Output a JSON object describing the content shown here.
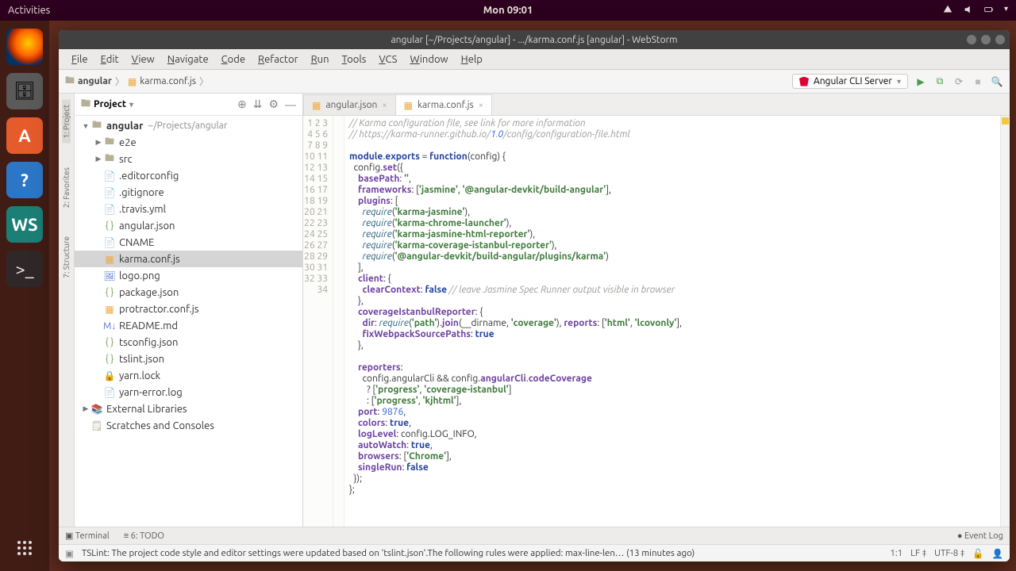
{
  "ubuntu": {
    "activities": "Activities",
    "clock": "Mon 09:01"
  },
  "window": {
    "title": "angular [~/Projects/angular] - .../karma.conf.js [angular] - WebStorm"
  },
  "menus": [
    "File",
    "Edit",
    "View",
    "Navigate",
    "Code",
    "Refactor",
    "Run",
    "Tools",
    "VCS",
    "Window",
    "Help"
  ],
  "breadcrumb": {
    "root": "angular",
    "file": "karma.conf.js"
  },
  "run_config": {
    "label": "Angular CLI Server"
  },
  "project_panel": {
    "title": "Project",
    "root_name": "angular",
    "root_path": "~/Projects/angular",
    "folders": [
      "e2e",
      "src"
    ],
    "files": [
      ".editorconfig",
      ".gitignore",
      ".travis.yml",
      "angular.json",
      "CNAME",
      "karma.conf.js",
      "logo.png",
      "package.json",
      "protractor.conf.js",
      "README.md",
      "tsconfig.json",
      "tslint.json",
      "yarn.lock",
      "yarn-error.log"
    ],
    "external": "External Libraries",
    "scratches": "Scratches and Consoles",
    "selected": "karma.conf.js"
  },
  "left_gutter": [
    "1: Project",
    "2: Favorites",
    "7: Structure"
  ],
  "editor_tabs": [
    {
      "name": "angular.json",
      "active": false
    },
    {
      "name": "karma.conf.js",
      "active": true
    }
  ],
  "code_lines": [
    "// Karma configuration file, see link for more information",
    "// https://karma-runner.github.io/1.0/config/configuration-file.html",
    "",
    "module.exports = function(config) {",
    "  config.set({",
    "    basePath: '',",
    "    frameworks: ['jasmine', '@angular-devkit/build-angular'],",
    "    plugins: [",
    "      require('karma-jasmine'),",
    "      require('karma-chrome-launcher'),",
    "      require('karma-jasmine-html-reporter'),",
    "      require('karma-coverage-istanbul-reporter'),",
    "      require('@angular-devkit/build-angular/plugins/karma')",
    "    ],",
    "    client: {",
    "      clearContext: false // leave Jasmine Spec Runner output visible in browser",
    "    },",
    "    coverageIstanbulReporter: {",
    "      dir: require('path').join(__dirname, 'coverage'), reports: ['html', 'lcovonly'],",
    "      fixWebpackSourcePaths: true",
    "    },",
    "",
    "    reporters:",
    "      config.angularCli && config.angularCli.codeCoverage",
    "        ? ['progress', 'coverage-istanbul']",
    "        : ['progress', 'kjhtml'],",
    "    port: 9876,",
    "    colors: true,",
    "    logLevel: config.LOG_INFO,",
    "    autoWatch: true,",
    "    browsers: ['Chrome'],",
    "    singleRun: false",
    "  });",
    "};"
  ],
  "bottom_tabs": {
    "terminal": "Terminal",
    "todo": "6: TODO",
    "event_log": "Event Log"
  },
  "status": {
    "msg": "TSLint: The project code style and editor settings were updated based on 'tslint.json'.The following rules were applied: max-line-len… (13 minutes ago)",
    "pos": "1:1",
    "sep": "LF",
    "enc": "UTF-8"
  }
}
